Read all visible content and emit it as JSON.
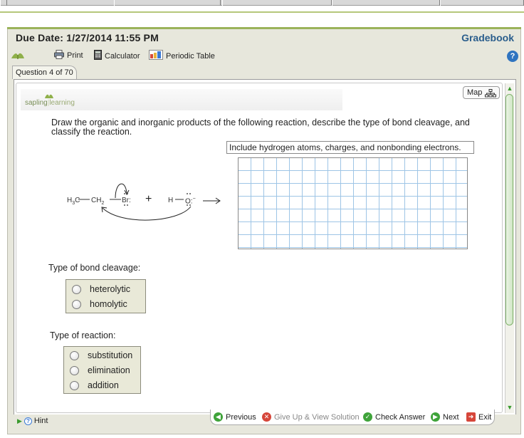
{
  "header": {
    "due_label": "Due Date:",
    "due_value": "1/27/2014 11:55 PM",
    "gradebook": "Gradebook"
  },
  "toolbar": {
    "print": "Print",
    "calculator": "Calculator",
    "periodic_table": "Periodic Table"
  },
  "question_tab": "Question 4 of 70",
  "brand": {
    "name": "sapling",
    "suffix": "learning"
  },
  "map_button": "Map",
  "prompt": "Draw the organic and inorganic products of the following reaction, describe the type of bond cleavage, and classify the reaction.",
  "drawing_hint": "Include hydrogen atoms, charges, and nonbonding electrons.",
  "reaction": {
    "reactant1": "H₃C—CH₂—Br:",
    "plus": "+",
    "reactant2": "H—O:⁻",
    "arrow": "→"
  },
  "bond_cleavage": {
    "label": "Type of bond cleavage:",
    "options": [
      "heterolytic",
      "homolytic"
    ]
  },
  "reaction_type": {
    "label": "Type of reaction:",
    "options": [
      "substitution",
      "elimination",
      "addition"
    ]
  },
  "footer": {
    "hint": "Hint",
    "previous": "Previous",
    "give_up": "Give Up & View Solution",
    "check": "Check Answer",
    "next": "Next",
    "exit": "Exit"
  },
  "colors": {
    "accent_green": "#9bb35a",
    "link_blue": "#2a5d8c",
    "grid_line": "#9ec5e6"
  }
}
